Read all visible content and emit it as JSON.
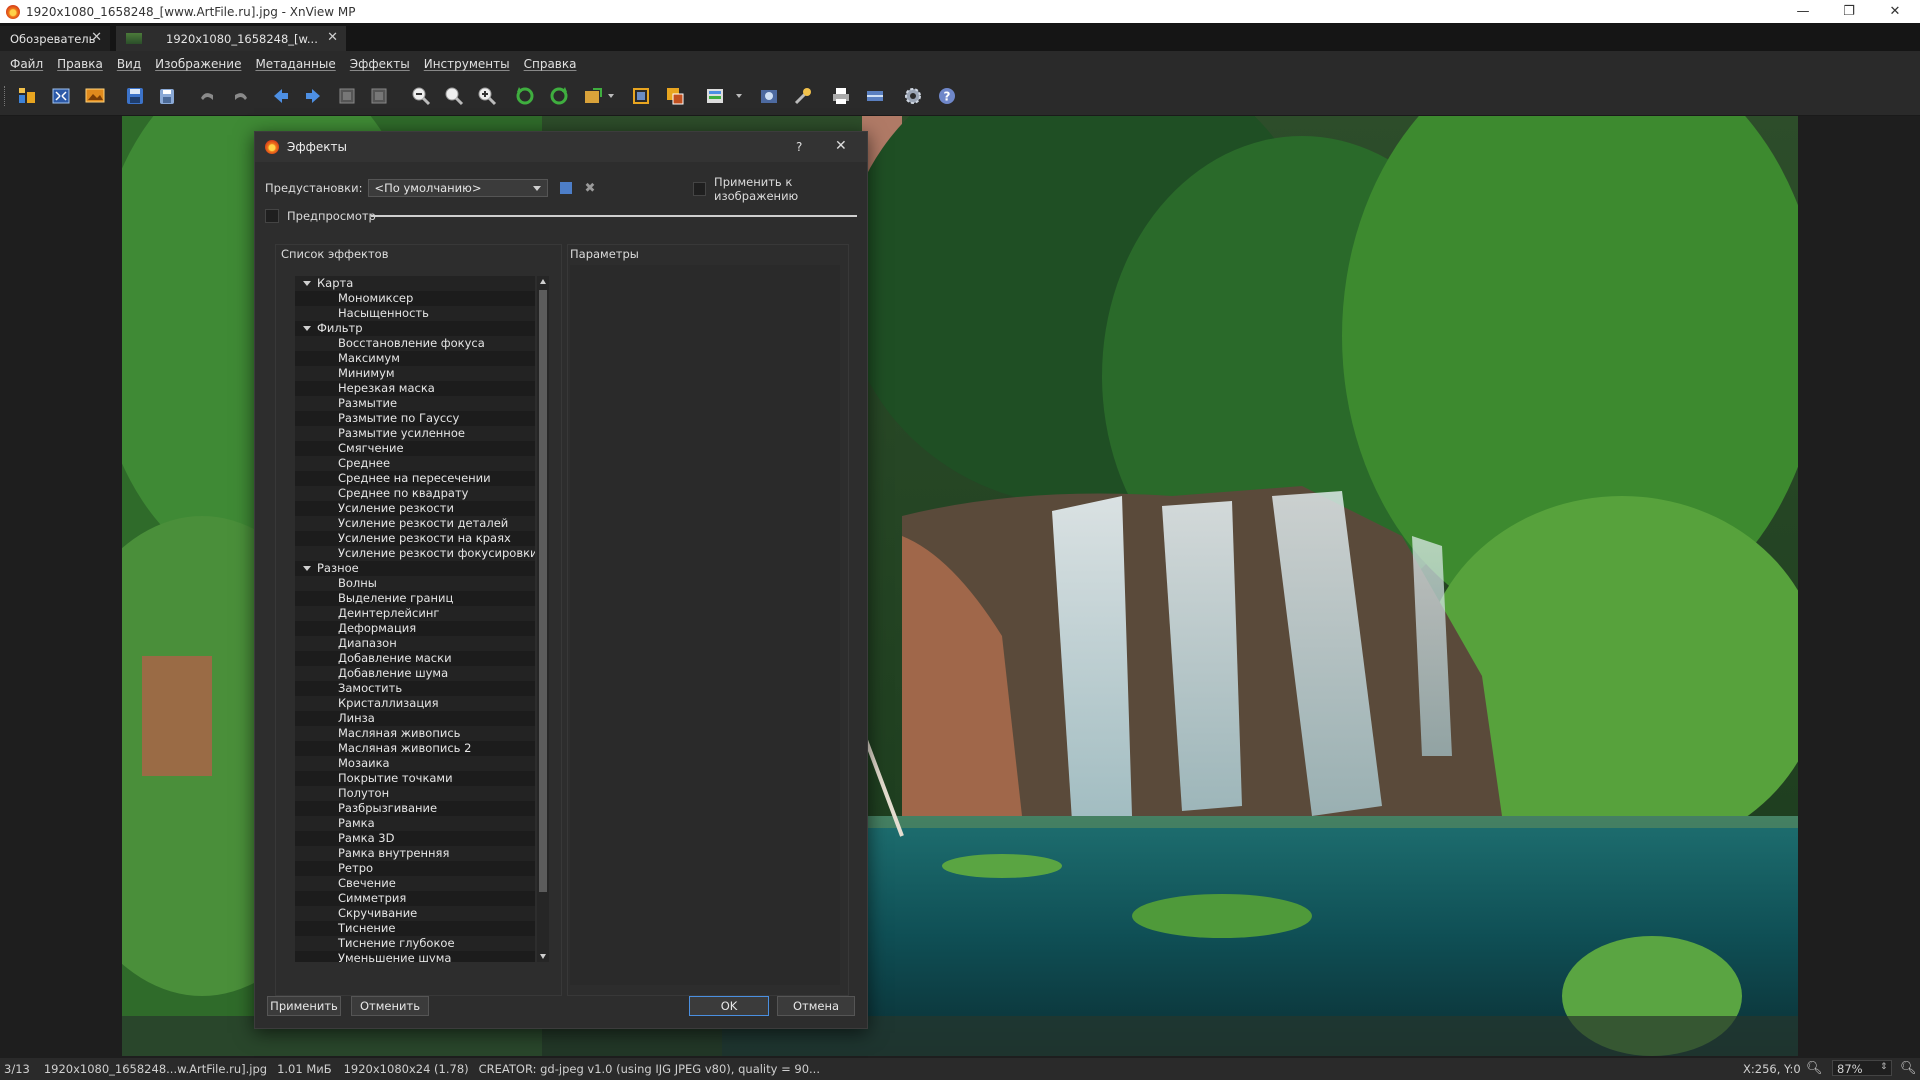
{
  "window": {
    "title": "1920x1080_1658248_[www.ArtFile.ru].jpg - XnView MP"
  },
  "tabs": [
    {
      "label": "Обозреватель"
    },
    {
      "label": "1920x1080_1658248_[w..."
    }
  ],
  "menu": [
    "Файл",
    "Правка",
    "Вид",
    "Изображение",
    "Метаданные",
    "Эффекты",
    "Инструменты",
    "Справка"
  ],
  "toolbar_icons": [
    "browser-icon",
    "fullscreen-icon",
    "image-icon",
    "save-icon",
    "save-as-icon",
    "undo-icon",
    "redo-icon",
    "previous-icon",
    "next-icon",
    "first-page-icon",
    "last-page-icon",
    "zoom-out-icon",
    "zoom-icon",
    "zoom-in-icon",
    "rotate-left-icon",
    "rotate-right-icon",
    "transform-icon",
    "crop-icon",
    "resize-icon",
    "adjust-icon",
    "capture-icon",
    "effects-icon",
    "print-icon",
    "scanner-icon",
    "settings-icon",
    "help-icon"
  ],
  "dialog": {
    "title": "Эффекты",
    "help": "?",
    "presets_label": "Предустановки:",
    "presets_value": "<По умолчанию>",
    "apply_to_image": "Применить к изображению",
    "preview": "Предпросмотр",
    "effects_list_label": "Список эффектов",
    "params_label": "Параметры",
    "tree": [
      {
        "label": "Карта",
        "type": "group"
      },
      {
        "label": "Мономиксер",
        "type": "leaf"
      },
      {
        "label": "Насыщенность",
        "type": "leaf"
      },
      {
        "label": "Фильтр",
        "type": "group"
      },
      {
        "label": "Восстановление фокуса",
        "type": "leaf"
      },
      {
        "label": "Максимум",
        "type": "leaf"
      },
      {
        "label": "Минимум",
        "type": "leaf"
      },
      {
        "label": "Нерезкая маска",
        "type": "leaf"
      },
      {
        "label": "Размытие",
        "type": "leaf"
      },
      {
        "label": "Размытие по Гауссу",
        "type": "leaf"
      },
      {
        "label": "Размытие усиленное",
        "type": "leaf"
      },
      {
        "label": "Смягчение",
        "type": "leaf"
      },
      {
        "label": "Среднее",
        "type": "leaf"
      },
      {
        "label": "Среднее на пересечении",
        "type": "leaf"
      },
      {
        "label": "Среднее по квадрату",
        "type": "leaf"
      },
      {
        "label": "Усиление резкости",
        "type": "leaf"
      },
      {
        "label": "Усиление резкости деталей",
        "type": "leaf"
      },
      {
        "label": "Усиление резкости на краях",
        "type": "leaf"
      },
      {
        "label": "Усиление резкости фокусировки",
        "type": "leaf"
      },
      {
        "label": "Разное",
        "type": "group"
      },
      {
        "label": "Волны",
        "type": "leaf"
      },
      {
        "label": "Выделение границ",
        "type": "leaf"
      },
      {
        "label": "Деинтерлейсинг",
        "type": "leaf"
      },
      {
        "label": "Деформация",
        "type": "leaf"
      },
      {
        "label": "Диапазон",
        "type": "leaf"
      },
      {
        "label": "Добавление маски",
        "type": "leaf"
      },
      {
        "label": "Добавление шума",
        "type": "leaf"
      },
      {
        "label": "Замостить",
        "type": "leaf"
      },
      {
        "label": "Кристаллизация",
        "type": "leaf"
      },
      {
        "label": "Линза",
        "type": "leaf"
      },
      {
        "label": "Масляная живопись",
        "type": "leaf"
      },
      {
        "label": "Масляная живопись 2",
        "type": "leaf"
      },
      {
        "label": "Мозаика",
        "type": "leaf"
      },
      {
        "label": "Покрытие точками",
        "type": "leaf"
      },
      {
        "label": "Полутон",
        "type": "leaf"
      },
      {
        "label": "Разбрызгивание",
        "type": "leaf"
      },
      {
        "label": "Рамка",
        "type": "leaf"
      },
      {
        "label": "Рамка 3D",
        "type": "leaf"
      },
      {
        "label": "Рамка внутренняя",
        "type": "leaf"
      },
      {
        "label": "Ретро",
        "type": "leaf"
      },
      {
        "label": "Свечение",
        "type": "leaf"
      },
      {
        "label": "Симметрия",
        "type": "leaf"
      },
      {
        "label": "Скручивание",
        "type": "leaf"
      },
      {
        "label": "Тиснение",
        "type": "leaf"
      },
      {
        "label": "Тиснение глубокое",
        "type": "leaf"
      },
      {
        "label": "Уменьшение шума",
        "type": "leaf"
      }
    ],
    "buttons": {
      "apply": "Применить",
      "undo": "Отменить",
      "ok": "OK",
      "cancel": "Отмена"
    }
  },
  "status": {
    "index": "3/13",
    "filename": "1920x1080_1658248...w.ArtFile.ru].jpg",
    "size": "1.01 МиБ",
    "dims": "1920x1080x24 (1.78)",
    "meta": "CREATOR: gd-jpeg v1.0 (using IJG JPEG v80), quality = 90...",
    "coords": "X:256, Y:0",
    "zoom": "87%"
  },
  "colors": {
    "accent": "#3b6fd6",
    "ok_border": "#4a8fe0"
  }
}
